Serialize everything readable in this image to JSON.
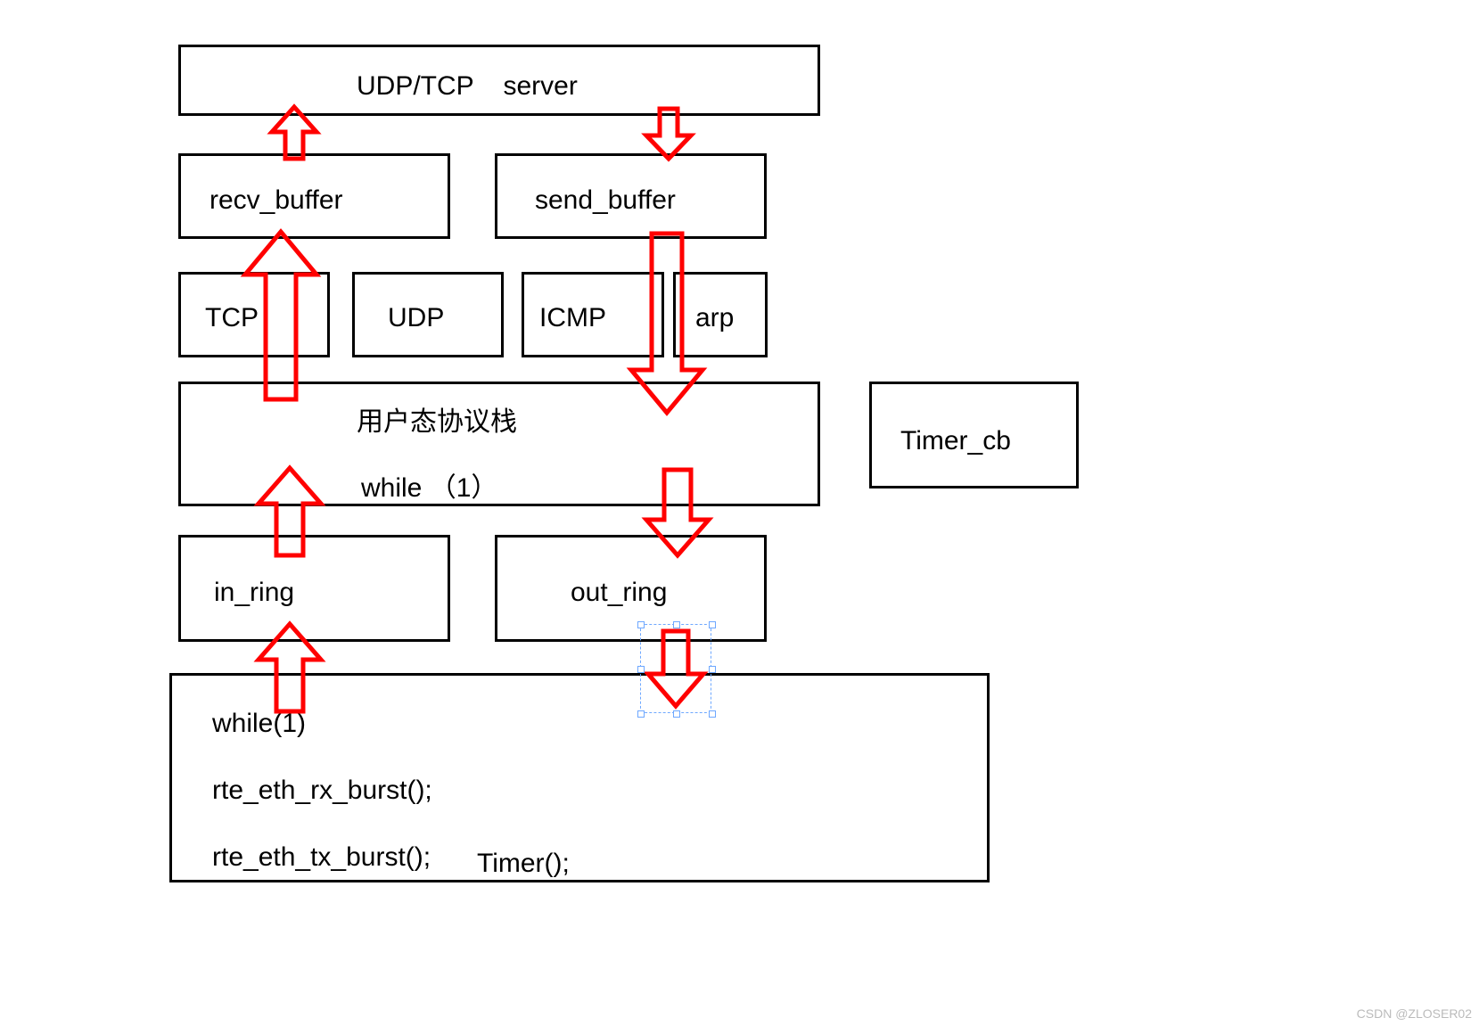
{
  "boxes": {
    "server": {
      "label": "UDP/TCP    server"
    },
    "recv_buffer": {
      "label": "recv_buffer"
    },
    "send_buffer": {
      "label": "send_buffer"
    },
    "tcp": {
      "label": "TCP"
    },
    "udp": {
      "label": "UDP"
    },
    "icmp": {
      "label": "ICMP"
    },
    "arp": {
      "label": "arp"
    },
    "userstack": {
      "line1": "用户态协议栈",
      "line2": "while （1）"
    },
    "timer_cb": {
      "label": "Timer_cb"
    },
    "in_ring": {
      "label": "in_ring"
    },
    "out_ring": {
      "label": "out_ring"
    },
    "bottom": {
      "l1": "while(1)",
      "l2": "rte_eth_rx_burst();",
      "l3": "rte_eth_tx_burst();",
      "l4": "Timer();"
    }
  },
  "watermark": "CSDN @ZLOSER02"
}
